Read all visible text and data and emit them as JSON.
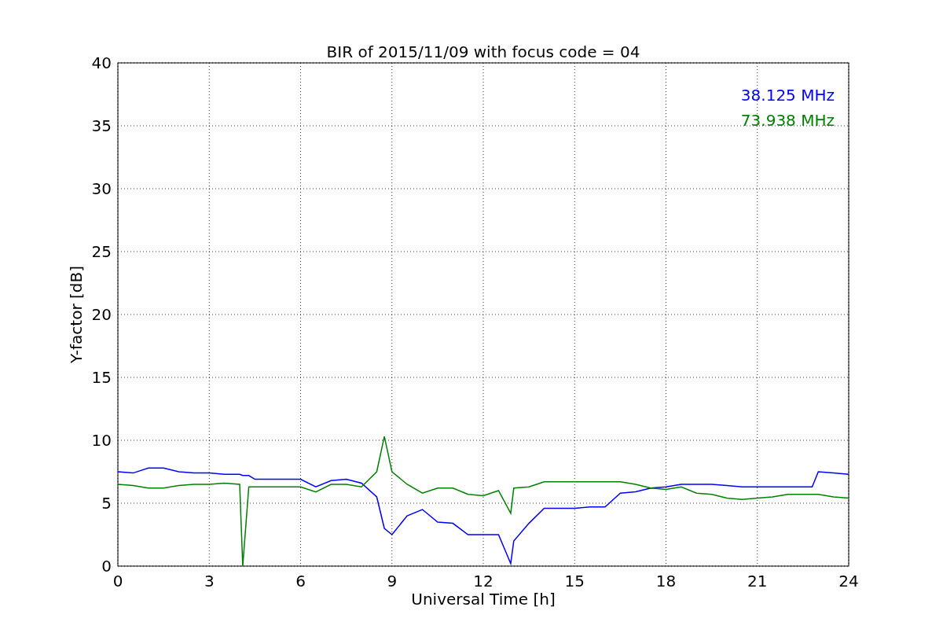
{
  "chart": {
    "chart_data": {
      "type": "line",
      "title": "BIR of 2015/11/09 with focus code = 04",
      "xlabel": "Universal Time [h]",
      "ylabel": "Y-factor [dB]",
      "x": [
        0,
        0.5,
        1,
        1.5,
        2,
        2.5,
        3,
        3.5,
        4,
        4.1,
        4.3,
        4.5,
        5,
        5.5,
        6,
        6.5,
        7,
        7.5,
        8,
        8.5,
        8.75,
        9,
        9.5,
        10,
        10.5,
        11,
        11.5,
        12,
        12.5,
        12.9,
        13,
        13.5,
        14,
        14.5,
        15,
        15.5,
        16,
        16.5,
        17,
        17.5,
        18,
        18.5,
        19,
        19.5,
        20,
        20.5,
        21,
        21.5,
        22,
        22.5,
        22.8,
        23,
        23.5,
        24
      ],
      "series": [
        {
          "name": "38.125 MHz",
          "color": "#0000ff",
          "values": [
            7.5,
            7.4,
            7.8,
            7.8,
            7.5,
            7.4,
            7.4,
            7.3,
            7.3,
            7.2,
            7.2,
            6.9,
            6.9,
            6.9,
            6.9,
            6.3,
            6.8,
            6.9,
            6.6,
            5.5,
            3.0,
            2.5,
            4.0,
            4.5,
            3.5,
            3.4,
            2.5,
            2.5,
            2.5,
            0.2,
            2.0,
            3.4,
            4.6,
            4.6,
            4.6,
            4.7,
            4.7,
            5.8,
            5.9,
            6.2,
            6.3,
            6.5,
            6.5,
            6.5,
            6.4,
            6.3,
            6.3,
            6.3,
            6.3,
            6.3,
            6.3,
            7.5,
            7.4,
            7.3
          ]
        },
        {
          "name": "73.938 MHz",
          "color": "#008000",
          "values": [
            6.5,
            6.4,
            6.2,
            6.2,
            6.4,
            6.5,
            6.5,
            6.6,
            6.5,
            0,
            6.3,
            6.3,
            6.3,
            6.3,
            6.3,
            5.9,
            6.5,
            6.5,
            6.3,
            7.5,
            10.3,
            7.5,
            6.5,
            5.8,
            6.2,
            6.2,
            5.7,
            5.6,
            6.0,
            4.2,
            6.2,
            6.3,
            6.7,
            6.7,
            6.7,
            6.7,
            6.7,
            6.7,
            6.5,
            6.2,
            6.1,
            6.3,
            5.8,
            5.7,
            5.4,
            5.3,
            5.4,
            5.5,
            5.7,
            5.7,
            5.7,
            5.7,
            5.5,
            5.4
          ]
        }
      ],
      "xlim": [
        0,
        24
      ],
      "ylim": [
        0,
        40
      ],
      "xticks": [
        0,
        3,
        6,
        9,
        12,
        15,
        18,
        21,
        24
      ],
      "yticks": [
        0,
        5,
        10,
        15,
        20,
        25,
        30,
        35,
        40
      ],
      "grid": true
    }
  }
}
